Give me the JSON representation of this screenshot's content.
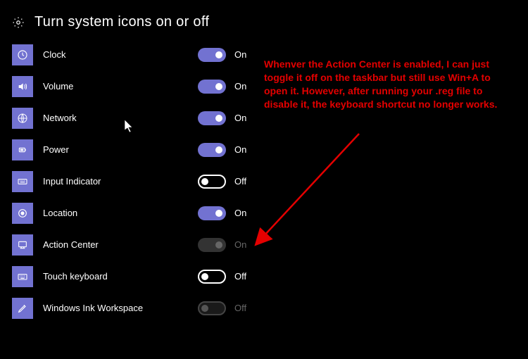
{
  "header": {
    "title": "Turn system icons on or off",
    "icon": "gear-icon"
  },
  "labels": {
    "on": "On",
    "off": "Off"
  },
  "items": [
    {
      "id": "clock",
      "label": "Clock",
      "icon": "clock-icon",
      "state": "on",
      "enabled": true
    },
    {
      "id": "volume",
      "label": "Volume",
      "icon": "volume-icon",
      "state": "on",
      "enabled": true
    },
    {
      "id": "network",
      "label": "Network",
      "icon": "network-icon",
      "state": "on",
      "enabled": true
    },
    {
      "id": "power",
      "label": "Power",
      "icon": "power-icon",
      "state": "on",
      "enabled": true
    },
    {
      "id": "input",
      "label": "Input Indicator",
      "icon": "input-icon",
      "state": "off",
      "enabled": true
    },
    {
      "id": "location",
      "label": "Location",
      "icon": "location-icon",
      "state": "on",
      "enabled": true
    },
    {
      "id": "action",
      "label": "Action Center",
      "icon": "action-icon",
      "state": "on",
      "enabled": false
    },
    {
      "id": "touch",
      "label": "Touch keyboard",
      "icon": "touch-icon",
      "state": "off",
      "enabled": true
    },
    {
      "id": "ink",
      "label": "Windows Ink Workspace",
      "icon": "ink-icon",
      "state": "off",
      "enabled": false
    }
  ],
  "annotation": {
    "text": "Whenver the Action Center is enabled, I can just toggle it off on the taskbar but still use Win+A to open it. However, after running your .reg file to disable it, the keyboard shortcut no longer works.",
    "color": "#e40000"
  }
}
